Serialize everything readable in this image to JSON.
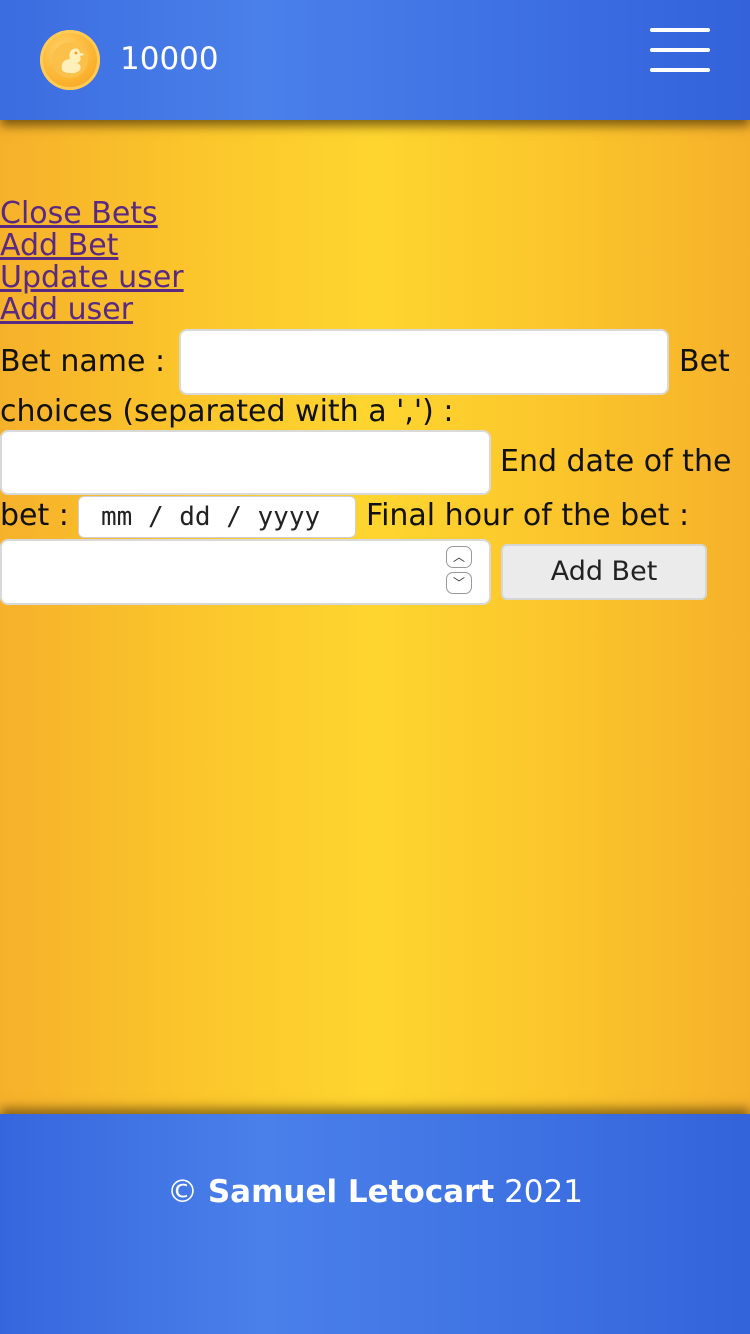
{
  "header": {
    "coin_icon": "coin-duck-icon",
    "balance": "10000",
    "menu_icon": "hamburger-menu-icon"
  },
  "nav": {
    "items": [
      {
        "label": "Close Bets"
      },
      {
        "label": "Add Bet"
      },
      {
        "label": "Update user"
      },
      {
        "label": "Add user"
      }
    ]
  },
  "form": {
    "bet_name_label": "Bet name :",
    "bet_name_value": "",
    "choices_label_part1": "Bet",
    "choices_label_part2": "choices (separated with a ',') :",
    "choices_value": "",
    "end_date_label_part1": "End date of the",
    "end_date_label_part2": "bet :",
    "end_date_placeholder": "mm / dd / yyyy",
    "final_hour_label": "Final hour of the bet :",
    "final_hour_value": "",
    "submit_label": "Add Bet"
  },
  "footer": {
    "copyright_symbol": "©",
    "author": "Samuel Letocart",
    "year": "2021"
  },
  "colors": {
    "header_blue": "#4a80ea",
    "background_yellow": "#fed52f",
    "link_purple": "#5a2a83"
  }
}
